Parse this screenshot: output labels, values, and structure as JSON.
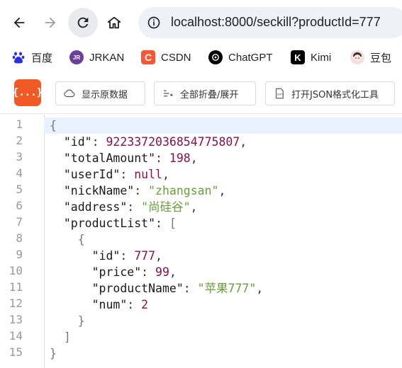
{
  "browser": {
    "url": "localhost:8000/seckill?productId=777"
  },
  "bookmarks": [
    {
      "label": "百度",
      "icon": "baidu-icon",
      "color": "#2932e1"
    },
    {
      "label": "JRKAN",
      "icon": "jrkan-icon",
      "color": "#6b3fa0"
    },
    {
      "label": "CSDN",
      "icon": "csdn-icon",
      "color": "#fc5531"
    },
    {
      "label": "ChatGPT",
      "icon": "chatgpt-icon",
      "color": "#000000"
    },
    {
      "label": "Kimi",
      "icon": "kimi-icon",
      "color": "#000000"
    },
    {
      "label": "豆包",
      "icon": "doubao-icon",
      "color": "#f2c5c5"
    }
  ],
  "toolbar": {
    "logo_text": "{...}",
    "show_raw": "显示原数据",
    "fold_all": "全部折叠/展开",
    "open_tool": "打开JSON格式化工具"
  },
  "json": {
    "id": "9223372036854775807",
    "totalAmount": "198",
    "userId": "null",
    "nickName": "\"zhangsan\"",
    "address": "\"尚硅谷\"",
    "productList": [
      {
        "id": "777",
        "price": "99",
        "productName": "\"苹果777\"",
        "num": "2"
      }
    ]
  },
  "line_numbers": [
    "1",
    "2",
    "3",
    "4",
    "5",
    "6",
    "7",
    "8",
    "9",
    "10",
    "11",
    "12",
    "13",
    "14",
    "15"
  ],
  "colors": {
    "accent": "#f15a24",
    "number": "#880e4f",
    "string": "#689f38",
    "highlight": "#e8f2ff"
  }
}
